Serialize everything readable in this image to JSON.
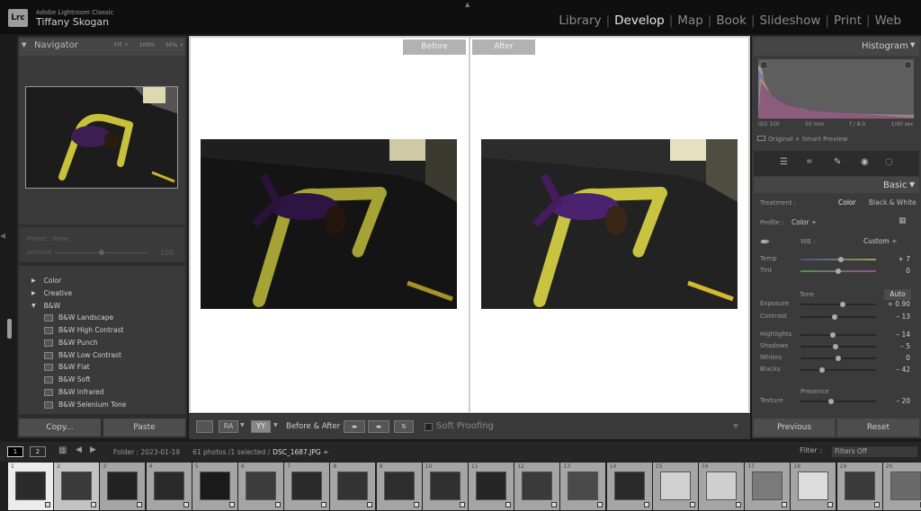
{
  "app": {
    "product": "Adobe Lightroom Classic",
    "user": "Tiffany Skogan",
    "logo": "Lrc"
  },
  "modules": [
    {
      "label": "Library",
      "active": false
    },
    {
      "label": "Develop",
      "active": true
    },
    {
      "label": "Map",
      "active": false
    },
    {
      "label": "Book",
      "active": false
    },
    {
      "label": "Slideshow",
      "active": false
    },
    {
      "label": "Print",
      "active": false
    },
    {
      "label": "Web",
      "active": false
    }
  ],
  "navigator": {
    "title": "Navigator",
    "zoom": [
      "FIT ÷",
      "100%",
      "50% ÷"
    ]
  },
  "preset": {
    "name_label": "Preset : None",
    "amount_label": "Amount",
    "amount_value": "100",
    "amount_fraction": 0.5
  },
  "presets": {
    "groups": [
      "Color",
      "Creative",
      "B&W"
    ],
    "bw_items": [
      "B&W Landscape",
      "B&W High Contrast",
      "B&W Punch",
      "B&W Low Contrast",
      "B&W Flat",
      "B&W Soft",
      "B&W Infrared",
      "B&W Selenium Tone"
    ]
  },
  "left_buttons": {
    "copy": "Copy...",
    "paste": "Paste"
  },
  "viewer": {
    "before": "Before",
    "after": "After"
  },
  "toolbar": {
    "ra": "RA",
    "yy": "YY",
    "before_after": "Before & After :",
    "soft_proofing": "Soft Proofing"
  },
  "histogram": {
    "title": "Histogram",
    "iso": "ISO 100",
    "focal": "50 mm",
    "aperture": "f / 8.0",
    "shutter": "1/60 sec",
    "smart_preview": "Original + Smart Preview"
  },
  "basic": {
    "title": "Basic",
    "treatment_label": "Treatment :",
    "treatment_color": "Color",
    "treatment_bw": "Black & White",
    "profile_label": "Profile :",
    "profile_value": "Color ÷",
    "wb_label": "WB :",
    "wb_value": "Custom ÷",
    "tone_label": "Tone",
    "auto_label": "Auto",
    "presence_label": "Presence"
  },
  "sliders": [
    {
      "label": "Temp",
      "value": "+ 7",
      "pos": 0.53
    },
    {
      "label": "Tint",
      "value": "0",
      "pos": 0.5
    },
    {
      "label": "Exposure",
      "value": "+ 0.90",
      "pos": 0.56
    },
    {
      "label": "Contrast",
      "value": "– 13",
      "pos": 0.45
    },
    {
      "label": "Highlights",
      "value": "– 14",
      "pos": 0.43
    },
    {
      "label": "Shadows",
      "value": "– 5",
      "pos": 0.47
    },
    {
      "label": "Whites",
      "value": "0",
      "pos": 0.5
    },
    {
      "label": "Blacks",
      "value": "– 42",
      "pos": 0.29
    },
    {
      "label": "Texture",
      "value": "– 20",
      "pos": 0.4
    }
  ],
  "right_buttons": {
    "previous": "Previous",
    "reset": "Reset"
  },
  "filmbar": {
    "screen1": "1",
    "screen2": "2",
    "path": "Folder : 2023-01-19",
    "count": "61 photos /1 selected /",
    "file": "DSC_1687.JPG ÷",
    "filter_label": "Filter :",
    "filter_value": "Filters Off"
  },
  "filmstrip": {
    "numbers": [
      "1",
      "2",
      "3",
      "4",
      "5",
      "6",
      "7",
      "8",
      "9",
      "10",
      "11",
      "12",
      "13",
      "14",
      "15",
      "16",
      "17",
      "18",
      "19",
      "20"
    ]
  },
  "colors": {
    "accent": "#e6e6e6",
    "panel": "#3b3b3b",
    "viewer_bg": "#ffffff",
    "slider_temp": "#8a7f3f",
    "slider_tint": "#6b3a6b"
  }
}
